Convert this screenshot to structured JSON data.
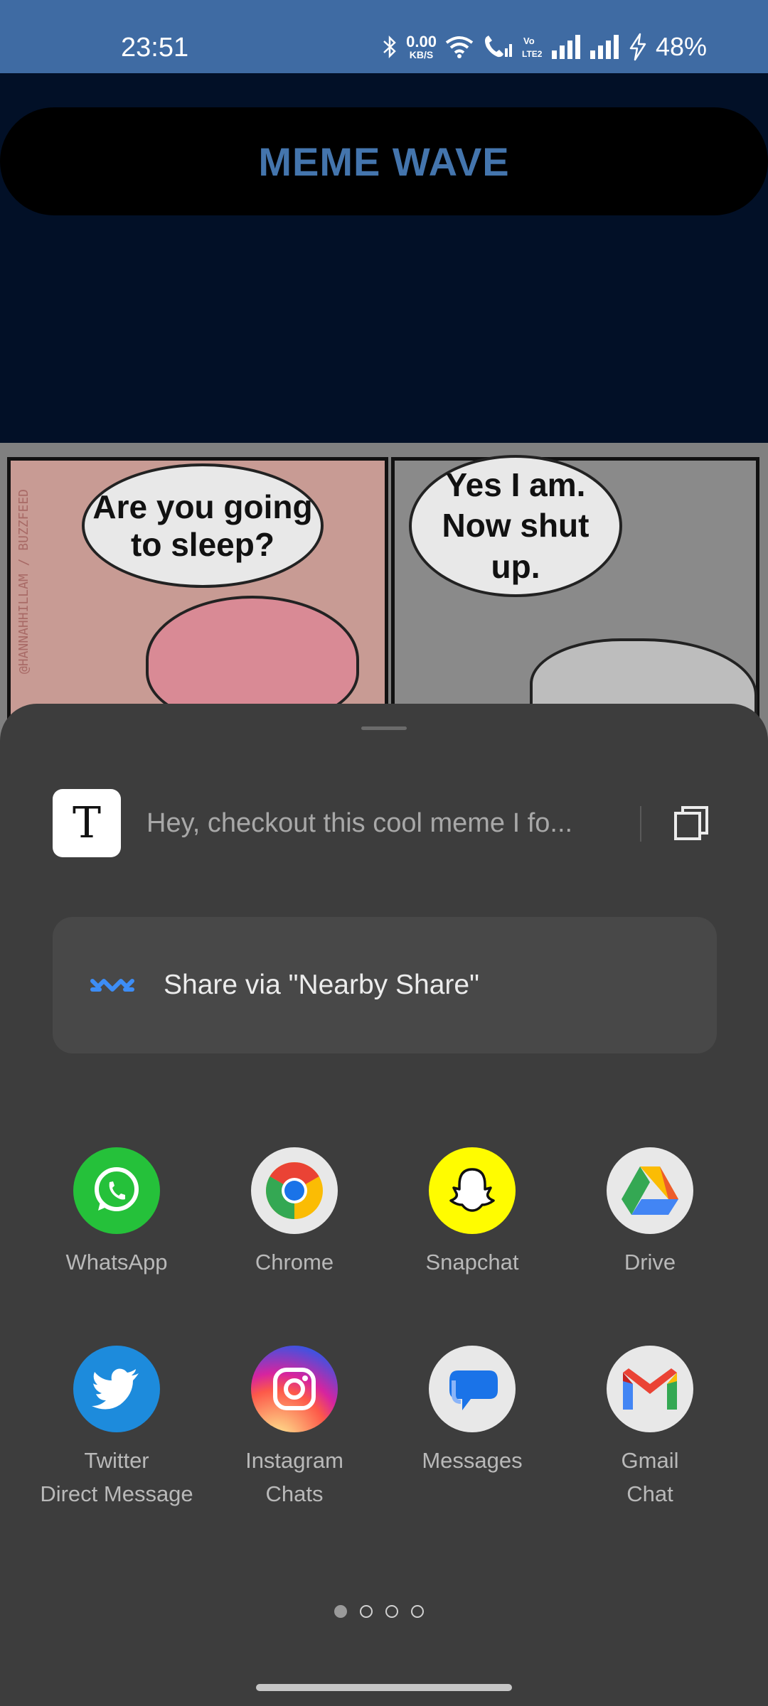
{
  "status_bar": {
    "time": "23:51",
    "speed_value": "0.00",
    "speed_unit": "KB/S",
    "volte_label": "Vo\nLTE2",
    "battery": "48%"
  },
  "app": {
    "title": "MEME WAVE",
    "meme": {
      "left_bubble": "Are you going\nto sleep?",
      "right_bubble": "Yes I am.\nNow shut\nup.",
      "credit": "@HANNAHHILLAM / BUZZFEED"
    }
  },
  "share_sheet": {
    "text_preview": {
      "icon_glyph": "T",
      "text": "Hey, checkout this cool meme I fo..."
    },
    "nearby_share_label": "Share via \"Nearby Share\"",
    "apps": [
      {
        "label": "WhatsApp",
        "icon": "whatsapp-icon",
        "color": "#25c13a"
      },
      {
        "label": "Chrome",
        "icon": "chrome-icon",
        "color": "#e8e8e8"
      },
      {
        "label": "Snapchat",
        "icon": "snapchat-icon",
        "color": "#fffc00"
      },
      {
        "label": "Drive",
        "icon": "drive-icon",
        "color": "#e8e8e8"
      },
      {
        "label": "Twitter\nDirect Message",
        "icon": "twitter-icon",
        "color": "#1d8bdc"
      },
      {
        "label": "Instagram\nChats",
        "icon": "instagram-icon",
        "color": "#d62976"
      },
      {
        "label": "Messages",
        "icon": "messages-icon",
        "color": "#e8e8e8"
      },
      {
        "label": "Gmail\nChat",
        "icon": "gmail-icon",
        "color": "#e8e8e8"
      }
    ],
    "page_indicator": {
      "pages": 4,
      "current": 1
    }
  }
}
